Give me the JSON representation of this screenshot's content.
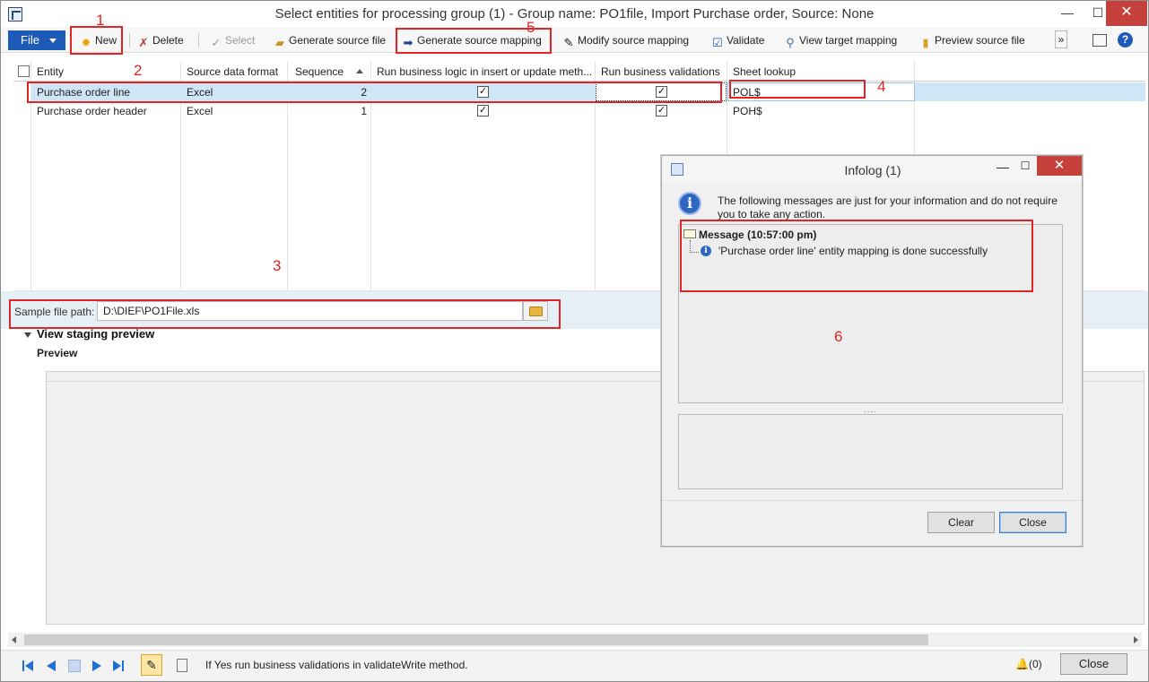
{
  "window": {
    "title": "Select entities for processing group (1) - Group name: PO1file, Import Purchase order, Source: None",
    "minimize": "—",
    "maximize": "☐",
    "close": "✕"
  },
  "toolbar": {
    "file": "File",
    "new": "New",
    "delete": "Delete",
    "select": "Select",
    "generate_source_file": "Generate source file",
    "generate_source_mapping": "Generate source mapping",
    "modify_source_mapping": "Modify source mapping",
    "validate": "Validate",
    "view_target_mapping": "View target mapping",
    "preview_source_file": "Preview source file",
    "overflow": "»"
  },
  "grid": {
    "columns": [
      "Entity",
      "Source data format",
      "Sequence",
      "Run business logic in insert or update meth...",
      "Run business validations",
      "Sheet lookup"
    ],
    "rows": [
      {
        "entity": "Purchase order line",
        "format": "Excel",
        "sequence": "2",
        "logic": "✓",
        "validations": "✓",
        "lookup": "POL$"
      },
      {
        "entity": "Purchase order header",
        "format": "Excel",
        "sequence": "1",
        "logic": "✓",
        "validations": "✓",
        "lookup": "POH$"
      }
    ]
  },
  "sample_file": {
    "label": "Sample file path:",
    "value": "D:\\DIEF\\PO1File.xls"
  },
  "staging": {
    "title": "View staging preview",
    "preview_label": "Preview"
  },
  "statusbar": {
    "text": "If Yes run business validations in validateWrite method.",
    "notifications": "(0)",
    "close": "Close"
  },
  "infolog": {
    "title": "Infolog (1)",
    "message": "The following messages are just for your information and do not require you to take any action.",
    "tree_header": "Message (10:57:00 pm)",
    "tree_item": "'Purchase order line' entity mapping is done successfully",
    "splitter": "....",
    "clear": "Clear",
    "close": "Close"
  },
  "annotations": [
    "1",
    "2",
    "3",
    "4",
    "5",
    "6"
  ],
  "colors": {
    "annotation": "#e22424",
    "file_button": "#1e5bb8",
    "selected_row": "#cfe6f7",
    "close_button": "#c7413c"
  }
}
